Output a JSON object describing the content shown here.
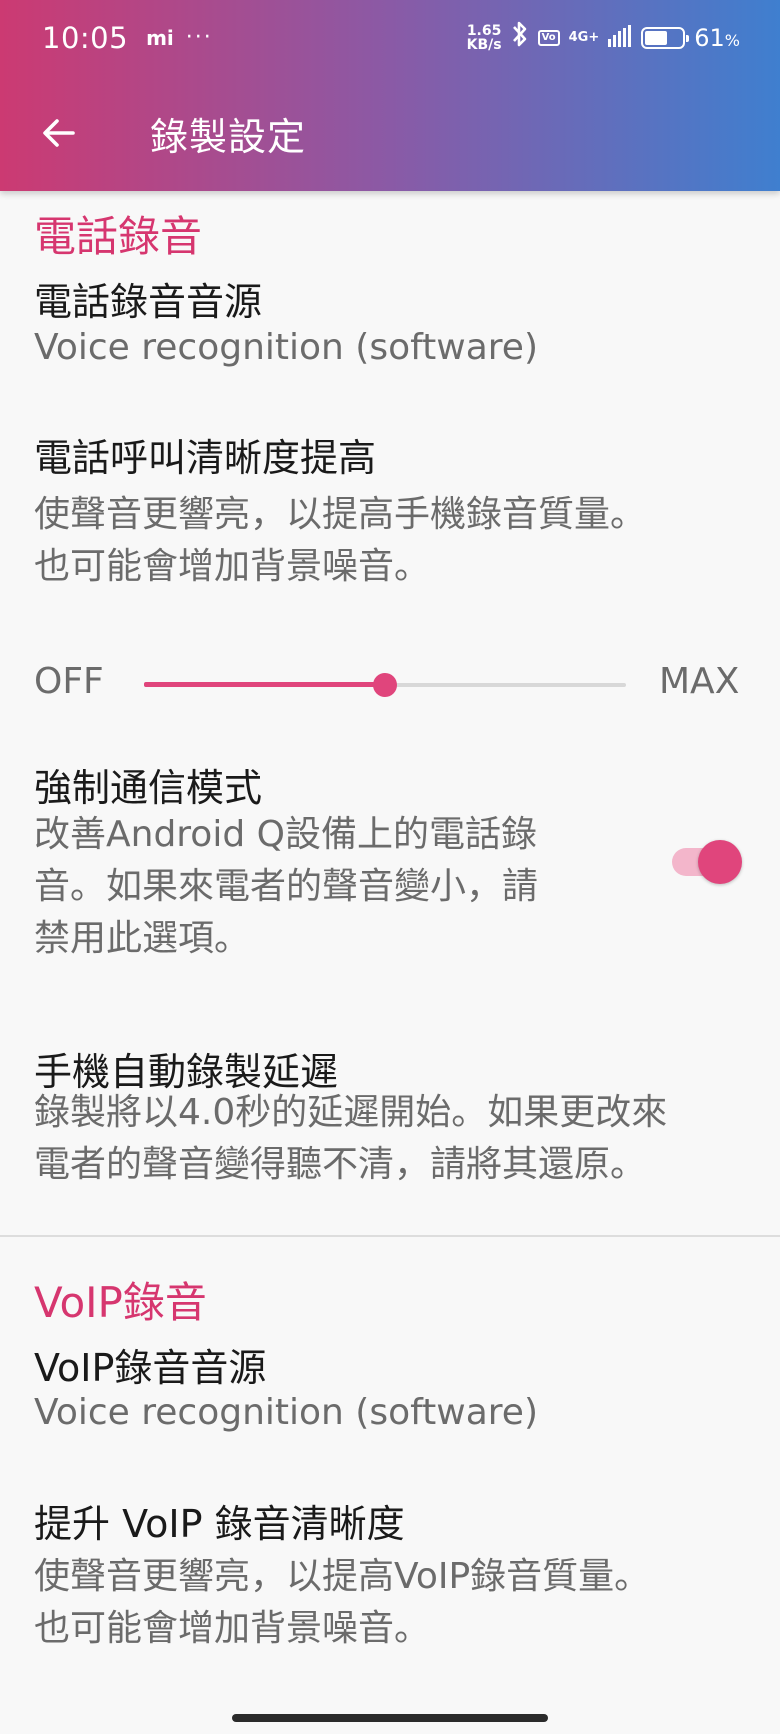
{
  "status_bar": {
    "time": "10:05",
    "mi": "mi",
    "dots": "···",
    "speed_value": "1.65",
    "speed_unit": "KB/s",
    "volte": "Vo",
    "network": "4G+",
    "battery_percent": "61",
    "battery_unit": "%",
    "battery_level": 0.61
  },
  "toolbar": {
    "title": "錄製設定"
  },
  "sections": {
    "phone": {
      "title": "電話錄音",
      "source": {
        "title": "電話錄音音源",
        "summary": "Voice recognition (software)"
      },
      "clarity": {
        "title": "電話呼叫清晰度提高",
        "summary_line1": "使聲音更響亮，以提高手機錄音質量。",
        "summary_line2": "也可能會增加背景噪音。",
        "min_label": "OFF",
        "max_label": "MAX",
        "value": 0.5
      },
      "comm_mode": {
        "title": "強制通信模式",
        "summary_line1": "改善Android Q設備上的電話錄",
        "summary_line2": "音。如果來電者的聲音變小，請",
        "summary_line3": "禁用此選項。",
        "enabled": true
      },
      "delay": {
        "title": "手機自動錄製延遲",
        "summary_line1": "錄製將以4.0秒的延遲開始。如果更改來",
        "summary_line2": "電者的聲音變得聽不清，請將其還原。"
      }
    },
    "voip": {
      "title": "VoIP錄音",
      "source": {
        "title": "VoIP錄音音源",
        "summary": "Voice recognition (software)"
      },
      "clarity": {
        "title": "提升 VoIP 錄音清晰度",
        "summary_line1": "使聲音更響亮，以提高VoIP錄音質量。",
        "summary_line2": "也可能會增加背景噪音。"
      }
    }
  },
  "colors": {
    "accent": "#e0457c",
    "section_title": "#d6366f",
    "header_gradient_start": "#cc3a72",
    "header_gradient_end": "#3f7fcf"
  }
}
